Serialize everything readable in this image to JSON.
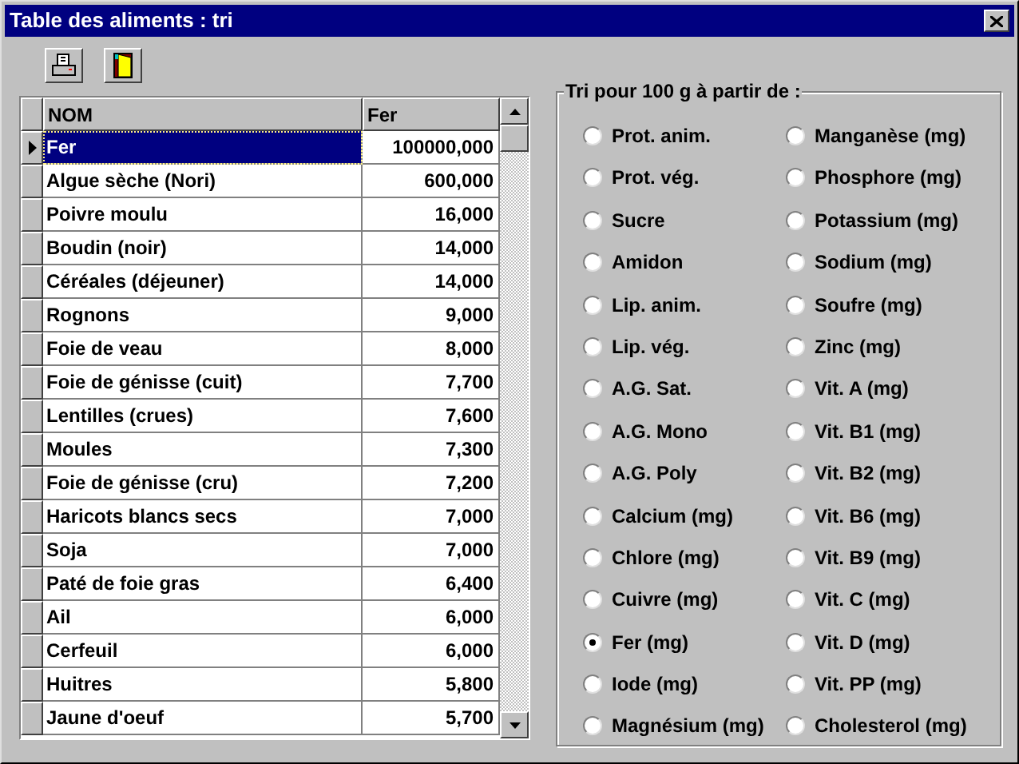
{
  "window": {
    "title": "Table des aliments : tri"
  },
  "table": {
    "columns": [
      "NOM",
      "Fer"
    ],
    "rows": [
      {
        "name": "Fer",
        "value": "100000,000",
        "selected": true
      },
      {
        "name": "Algue sèche (Nori)",
        "value": "600,000",
        "selected": false
      },
      {
        "name": "Poivre moulu",
        "value": "16,000",
        "selected": false
      },
      {
        "name": "Boudin (noir)",
        "value": "14,000",
        "selected": false
      },
      {
        "name": "Céréales (déjeuner)",
        "value": "14,000",
        "selected": false
      },
      {
        "name": "Rognons",
        "value": "9,000",
        "selected": false
      },
      {
        "name": "Foie de veau",
        "value": "8,000",
        "selected": false
      },
      {
        "name": "Foie de génisse (cuit)",
        "value": "7,700",
        "selected": false
      },
      {
        "name": "Lentilles (crues)",
        "value": "7,600",
        "selected": false
      },
      {
        "name": "Moules",
        "value": "7,300",
        "selected": false
      },
      {
        "name": "Foie de génisse (cru)",
        "value": "7,200",
        "selected": false
      },
      {
        "name": "Haricots blancs secs",
        "value": "7,000",
        "selected": false
      },
      {
        "name": "Soja",
        "value": "7,000",
        "selected": false
      },
      {
        "name": "Paté de foie gras",
        "value": "6,400",
        "selected": false
      },
      {
        "name": "Ail",
        "value": "6,000",
        "selected": false
      },
      {
        "name": "Cerfeuil",
        "value": "6,000",
        "selected": false
      },
      {
        "name": "Huitres",
        "value": "5,800",
        "selected": false
      },
      {
        "name": "Jaune d'oeuf",
        "value": "5,700",
        "selected": false
      }
    ]
  },
  "sort_group": {
    "title": "Tri pour 100 g à partir de :",
    "options": [
      {
        "label": "Prot. anim.",
        "selected": false
      },
      {
        "label": "Prot. vég.",
        "selected": false
      },
      {
        "label": "Sucre",
        "selected": false
      },
      {
        "label": "Amidon",
        "selected": false
      },
      {
        "label": "Lip. anim.",
        "selected": false
      },
      {
        "label": "Lip. vég.",
        "selected": false
      },
      {
        "label": "A.G. Sat.",
        "selected": false
      },
      {
        "label": "A.G. Mono",
        "selected": false
      },
      {
        "label": "A.G. Poly",
        "selected": false
      },
      {
        "label": "Calcium (mg)",
        "selected": false
      },
      {
        "label": "Chlore (mg)",
        "selected": false
      },
      {
        "label": "Cuivre (mg)",
        "selected": false
      },
      {
        "label": "Fer (mg)",
        "selected": true
      },
      {
        "label": "Iode (mg)",
        "selected": false
      },
      {
        "label": "Magnésium (mg)",
        "selected": false
      },
      {
        "label": "Manganèse (mg)",
        "selected": false
      },
      {
        "label": "Phosphore (mg)",
        "selected": false
      },
      {
        "label": "Potassium (mg)",
        "selected": false
      },
      {
        "label": "Sodium (mg)",
        "selected": false
      },
      {
        "label": "Soufre (mg)",
        "selected": false
      },
      {
        "label": "Zinc (mg)",
        "selected": false
      },
      {
        "label": "Vit. A (mg)",
        "selected": false
      },
      {
        "label": "Vit. B1 (mg)",
        "selected": false
      },
      {
        "label": "Vit. B2 (mg)",
        "selected": false
      },
      {
        "label": "Vit. B6 (mg)",
        "selected": false
      },
      {
        "label": "Vit. B9 (mg)",
        "selected": false
      },
      {
        "label": "Vit. C (mg)",
        "selected": false
      },
      {
        "label": "Vit. D (mg)",
        "selected": false
      },
      {
        "label": "Vit. PP (mg)",
        "selected": false
      },
      {
        "label": "Cholesterol (mg)",
        "selected": false
      }
    ]
  }
}
